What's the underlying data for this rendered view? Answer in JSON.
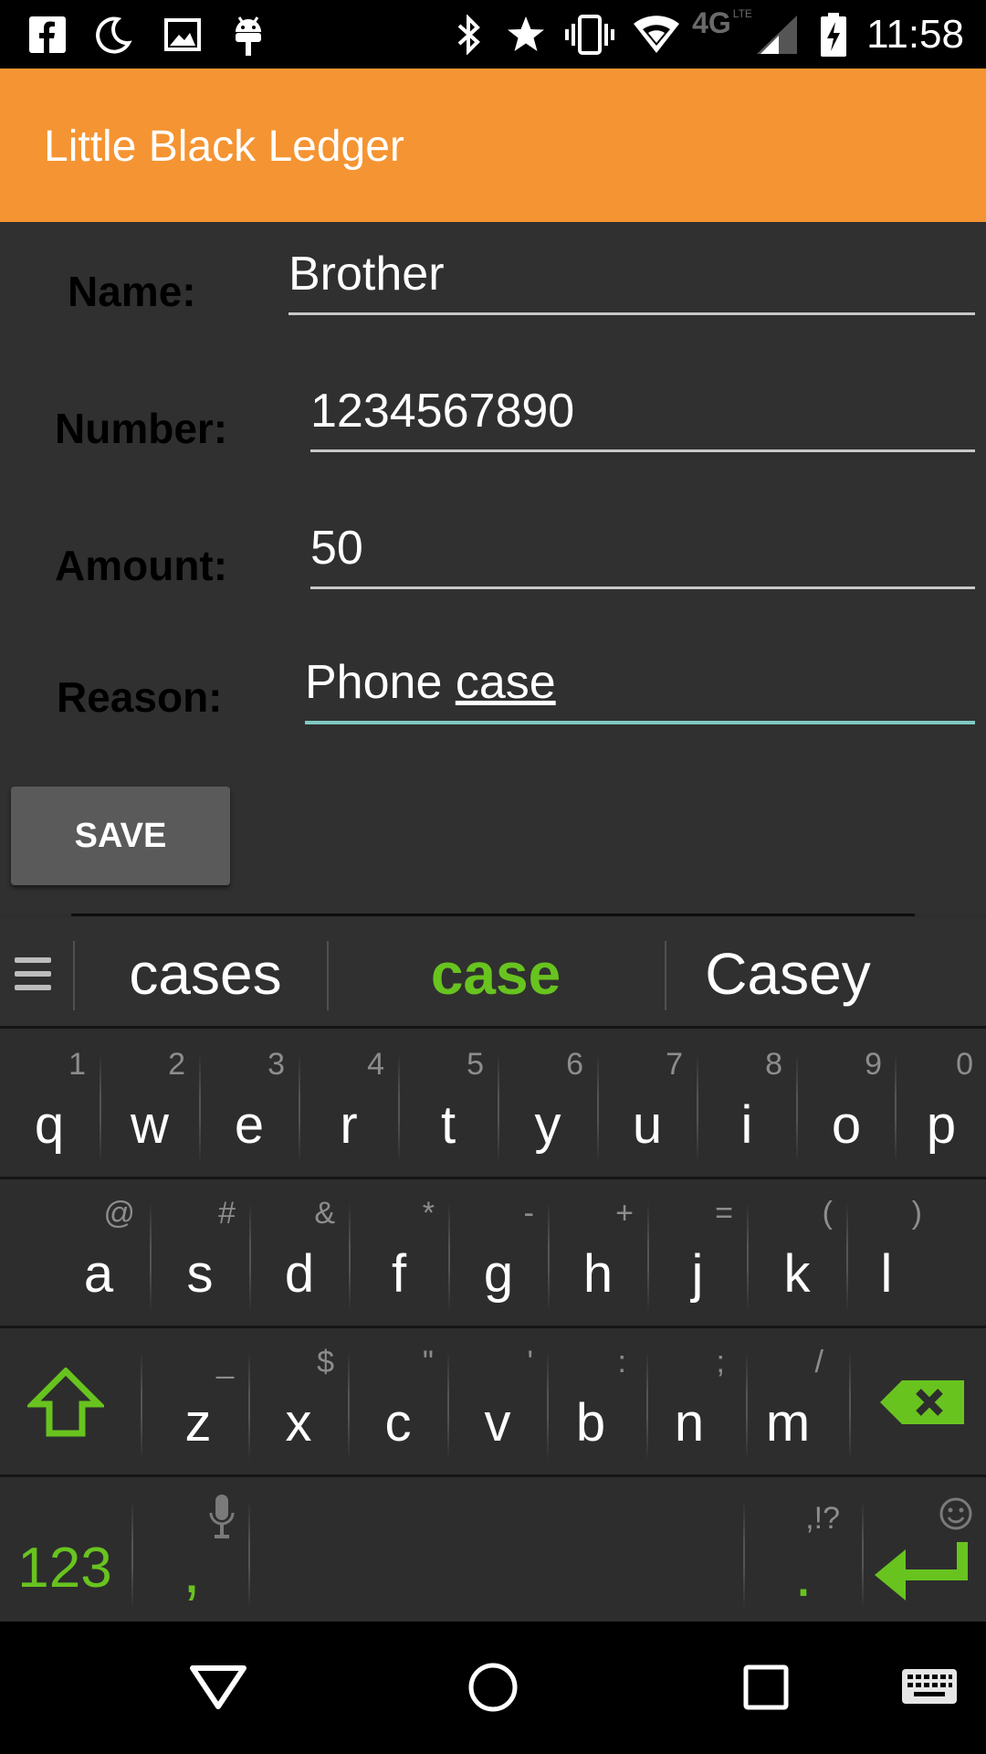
{
  "status_bar": {
    "time": "11:58",
    "left_icons": [
      "facebook-icon",
      "moon-icon",
      "image-icon",
      "android-icon"
    ],
    "right_icons": [
      "bluetooth-icon",
      "star-icon",
      "vibrate-icon",
      "wifi-icon",
      "4g-lte-icon",
      "signal-icon",
      "battery-charging-icon"
    ],
    "network_label": "4G"
  },
  "app_bar": {
    "title": "Little Black Ledger",
    "color": "#F59432"
  },
  "form": {
    "name_label": "Name:",
    "name_value": "Brother",
    "number_label": "Number:",
    "number_value": "1234567890",
    "amount_label": "Amount:",
    "amount_value": "50",
    "reason_label": "Reason:",
    "reason_value_prefix": "Phone ",
    "reason_value_composing": "case",
    "save_label": "SAVE"
  },
  "keyboard": {
    "suggestions": [
      "cases",
      "case",
      "Casey"
    ],
    "accent": "#68C31F",
    "row1": [
      {
        "ch": "q",
        "hint": "1"
      },
      {
        "ch": "w",
        "hint": "2"
      },
      {
        "ch": "e",
        "hint": "3"
      },
      {
        "ch": "r",
        "hint": "4"
      },
      {
        "ch": "t",
        "hint": "5"
      },
      {
        "ch": "y",
        "hint": "6"
      },
      {
        "ch": "u",
        "hint": "7"
      },
      {
        "ch": "i",
        "hint": "8"
      },
      {
        "ch": "o",
        "hint": "9"
      },
      {
        "ch": "p",
        "hint": "0"
      }
    ],
    "row2": [
      {
        "ch": "a",
        "hint": "@"
      },
      {
        "ch": "s",
        "hint": "#"
      },
      {
        "ch": "d",
        "hint": "&"
      },
      {
        "ch": "f",
        "hint": "*"
      },
      {
        "ch": "g",
        "hint": "-"
      },
      {
        "ch": "h",
        "hint": "+"
      },
      {
        "ch": "j",
        "hint": "="
      },
      {
        "ch": "k",
        "hint": "("
      },
      {
        "ch": "l",
        "hint": ")"
      }
    ],
    "row3": [
      {
        "ch": "z",
        "hint": "_"
      },
      {
        "ch": "x",
        "hint": "$"
      },
      {
        "ch": "c",
        "hint": "\""
      },
      {
        "ch": "v",
        "hint": "'"
      },
      {
        "ch": "b",
        "hint": ":"
      },
      {
        "ch": "n",
        "hint": ";"
      },
      {
        "ch": "m",
        "hint": "/"
      }
    ],
    "symbols_label": "123",
    "comma_label": ",",
    "period_label": ".",
    "period_hint": ",!?"
  },
  "nav_bar": {
    "icons": [
      "back-icon",
      "home-icon",
      "recents-icon",
      "keyboard-icon"
    ]
  }
}
